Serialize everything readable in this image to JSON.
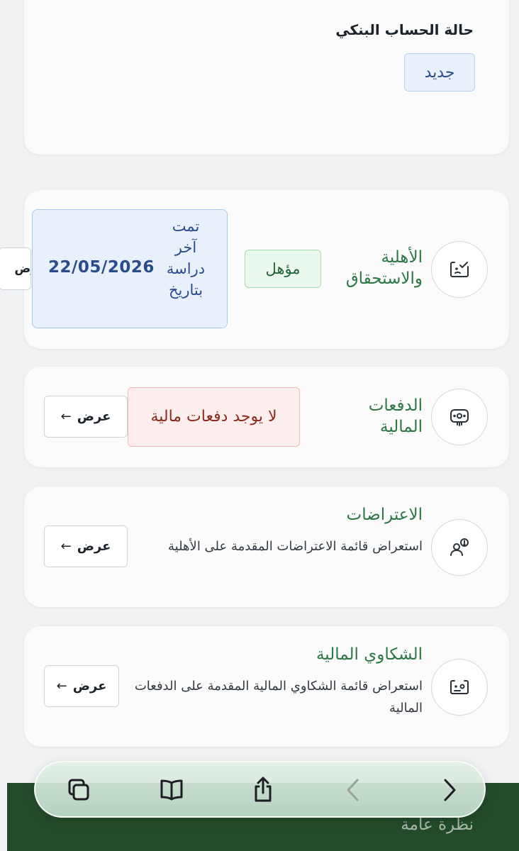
{
  "bank_status": {
    "title": "حالة الحساب البنكي",
    "badge": "جديد"
  },
  "eligibility": {
    "title_line1": "الأهلية",
    "title_line2": "والاستحقاق",
    "status": "مؤهل",
    "study_label": "تمت آخر دراسة بتاريخ",
    "study_date": "22/05/2026",
    "view_label_partial": "رض"
  },
  "payments": {
    "title_line1": "الدفعات",
    "title_line2": "المالية",
    "status": "لا يوجد دفعات مالية",
    "view_label": "عرض",
    "arrow": "←"
  },
  "objections": {
    "title": "الاعتراضات",
    "description": "استعراض قائمة الاعتراضات المقدمة على الأهلية",
    "view_label": "عرض",
    "arrow": "←"
  },
  "complaints": {
    "title": "الشكاوي المالية",
    "description": "استعراض قائمة الشكاوي المالية المقدمة على الدفعات المالية",
    "view_label": "عرض",
    "arrow": "←"
  },
  "bottom_nav": {
    "label": "نظرة عامة"
  },
  "toolbar": {
    "icons": [
      "tabs-icon",
      "bookmarks-icon",
      "share-icon",
      "back-icon",
      "forward-icon"
    ]
  },
  "colors": {
    "accent_green": "#2d7746",
    "nav_dark_green": "#234b2a",
    "info_blue": "#2a4c8c",
    "error_red": "#8b2a1f"
  }
}
